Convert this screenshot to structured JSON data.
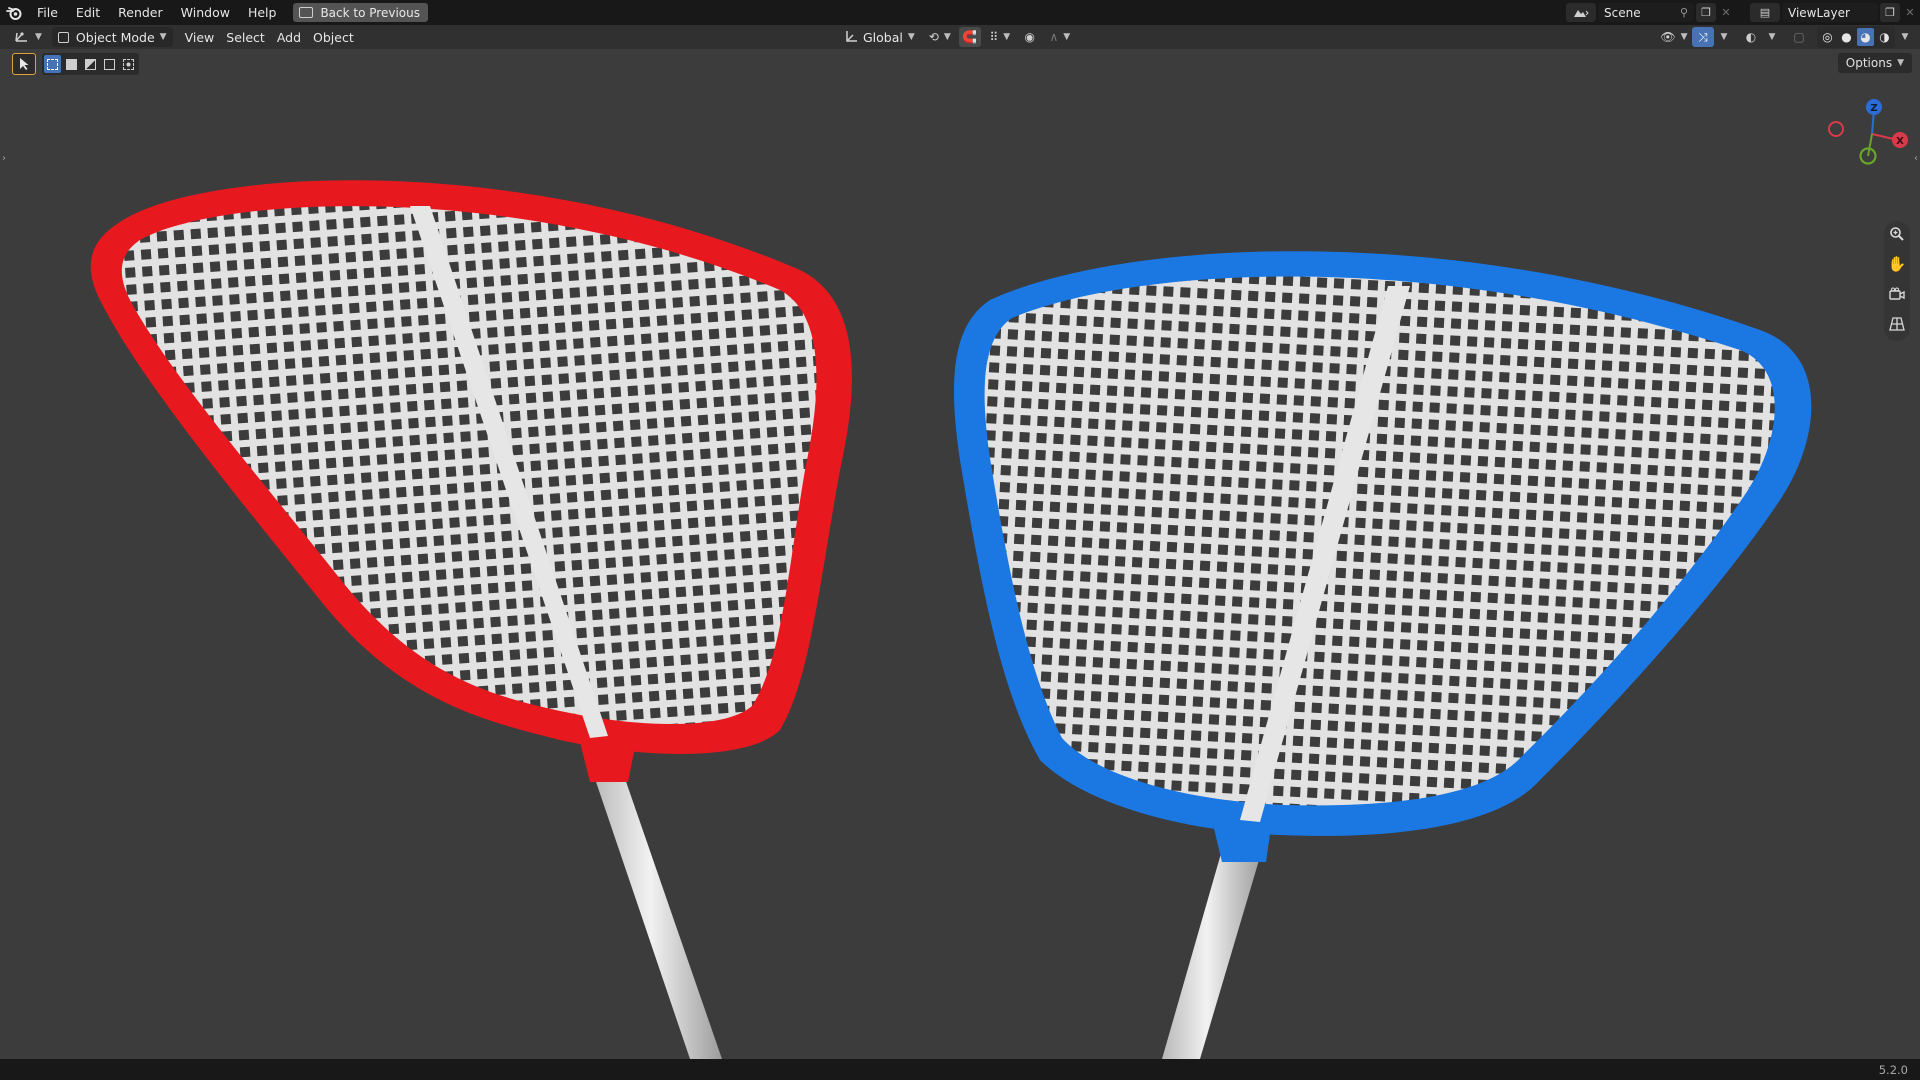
{
  "topbar": {
    "menus": [
      "File",
      "Edit",
      "Render",
      "Window",
      "Help"
    ],
    "back_label": "Back to Previous",
    "scene_name": "Scene",
    "view_layer": "ViewLayer"
  },
  "viewport_header": {
    "mode": "Object Mode",
    "menus": [
      "View",
      "Select",
      "Add",
      "Object"
    ],
    "transform_orientation": "Global"
  },
  "toolbar": {
    "options_label": "Options"
  },
  "gizmo": {
    "axis_z": "Z",
    "axis_x": "X"
  },
  "scene": {
    "objects": [
      {
        "name": "red-fly-swatter",
        "color": "#e8191e"
      },
      {
        "name": "blue-fly-swatter",
        "color": "#1b78e3"
      }
    ],
    "mesh_color": "#dedede",
    "background": "#3c3c3c"
  },
  "statusbar": {
    "version": "5.2.0"
  },
  "colors": {
    "accent": "#4772b3",
    "topbar_bg": "#181818",
    "header_bg": "#303030"
  }
}
